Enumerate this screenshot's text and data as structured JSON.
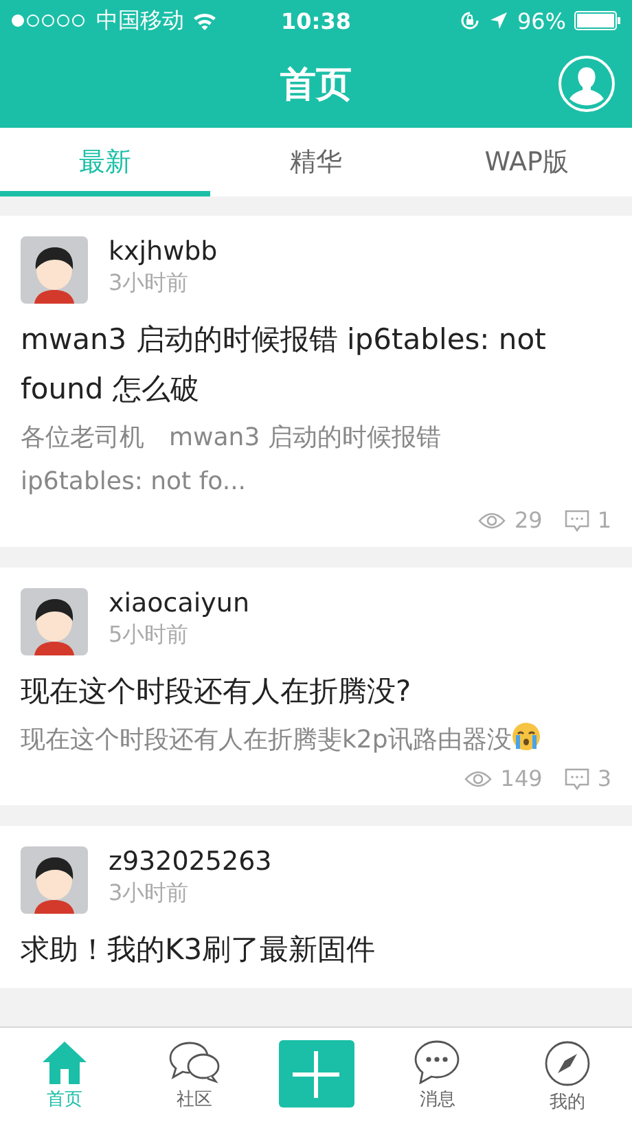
{
  "status_bar": {
    "carrier": "中国移动",
    "time": "10:38",
    "battery": "96%"
  },
  "header": {
    "title": "首页"
  },
  "tabs": [
    {
      "label": "最新",
      "selected": true
    },
    {
      "label": "精华",
      "selected": false
    },
    {
      "label": "WAP版",
      "selected": false
    }
  ],
  "posts": [
    {
      "user": "kxjhwbb",
      "time": "3小时前",
      "title": "mwan3 启动的时候报错 ip6tables: not found 怎么破",
      "excerpt": "各位老司机　mwan3 启动的时候报错 ip6tables: not fo...",
      "views": "29",
      "comments": "1"
    },
    {
      "user": "xiaocaiyun",
      "time": "5小时前",
      "title": "现在这个时段还有人在折腾没?",
      "excerpt": "现在这个时段还有人在折腾斐k2p讯路由器没",
      "emoji": true,
      "views": "149",
      "comments": "3"
    },
    {
      "user": "z932025263",
      "time": "3小时前",
      "title": "求助！我的K3刷了最新固件"
    }
  ],
  "bottom_nav": [
    {
      "kind": "home",
      "label": "首页",
      "selected": true
    },
    {
      "kind": "community",
      "label": "社区",
      "selected": false
    },
    {
      "kind": "add"
    },
    {
      "kind": "messages",
      "label": "消息",
      "selected": false
    },
    {
      "kind": "discover",
      "label": "我的",
      "selected": false
    }
  ]
}
